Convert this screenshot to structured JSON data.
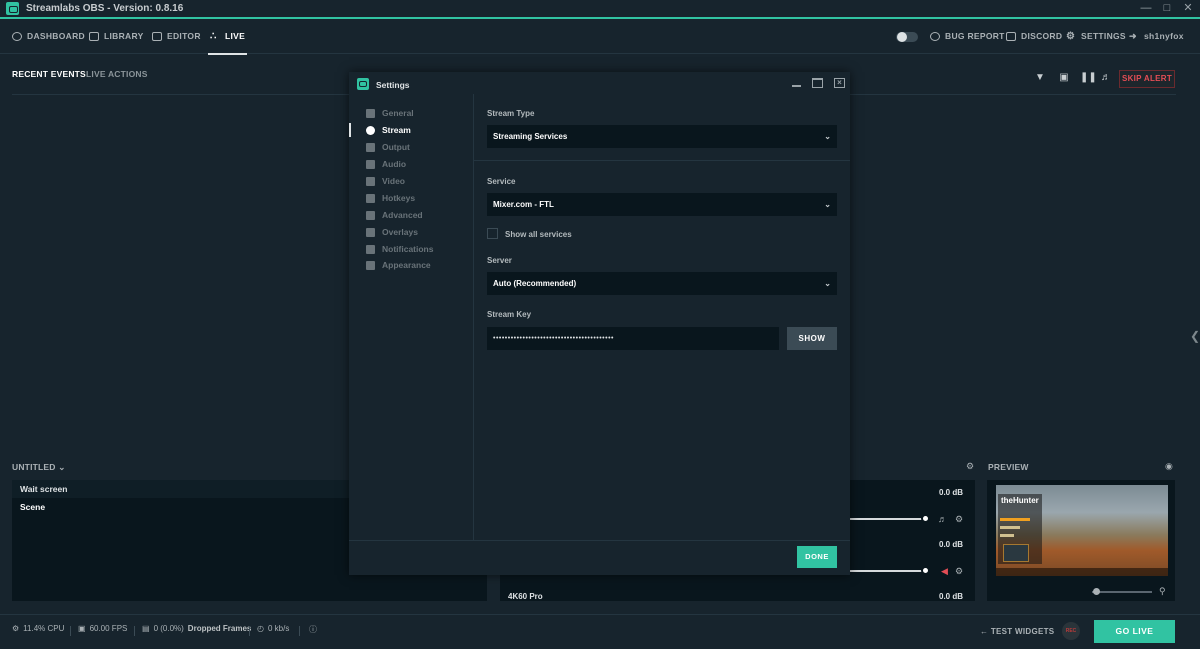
{
  "app": {
    "title": "Streamlabs OBS - Version: 0.8.16"
  },
  "nav": {
    "left": [
      {
        "label": "DASHBOARD",
        "icon": "dashboard-icon"
      },
      {
        "label": "LIBRARY",
        "icon": "image-icon"
      },
      {
        "label": "EDITOR",
        "icon": "editor-icon"
      },
      {
        "label": "LIVE",
        "icon": "broadcast-icon",
        "active": true
      }
    ],
    "right": [
      {
        "label": "BUG REPORT",
        "icon": "bug-icon"
      },
      {
        "label": "DISCORD",
        "icon": "discord-icon"
      },
      {
        "label": "SETTINGS",
        "icon": "gear-icon"
      },
      {
        "label": "sh1nyfox",
        "icon": "logout-icon"
      }
    ]
  },
  "events": {
    "tabs": [
      "RECENT EVENTS",
      "LIVE ACTIONS"
    ],
    "skip_alert": "SKIP ALERT"
  },
  "scenes": {
    "collection": "UNTITLED",
    "items": [
      "Wait screen",
      "Scene"
    ]
  },
  "mixer": {
    "items": [
      {
        "name": "",
        "db": "0.0 dB"
      },
      {
        "name": "",
        "db": "0.0 dB"
      },
      {
        "name": "4K60 Pro",
        "db": "0.0 dB"
      }
    ]
  },
  "preview": {
    "label": "PREVIEW",
    "game_title": "theHunter"
  },
  "footer": {
    "cpu": "11.4% CPU",
    "fps": "60.00 FPS",
    "dropped_count": "0 (0.0%)",
    "dropped_label": "Dropped Frames",
    "bitrate": "0 kb/s",
    "test_widgets": "TEST WIDGETS",
    "rec": "REC",
    "go_live": "GO LIVE"
  },
  "settings": {
    "title": "Settings",
    "sidebar": [
      {
        "label": "General",
        "icon": "grid-icon"
      },
      {
        "label": "Stream",
        "icon": "globe-icon",
        "active": true
      },
      {
        "label": "Output",
        "icon": "output-icon"
      },
      {
        "label": "Audio",
        "icon": "speaker-icon"
      },
      {
        "label": "Video",
        "icon": "film-icon"
      },
      {
        "label": "Hotkeys",
        "icon": "keyboard-icon"
      },
      {
        "label": "Advanced",
        "icon": "cogs-icon"
      },
      {
        "label": "Overlays",
        "icon": "image-icon"
      },
      {
        "label": "Notifications",
        "icon": "warning-icon"
      },
      {
        "label": "Appearance",
        "icon": "monitor-icon"
      }
    ],
    "stream_type": {
      "label": "Stream Type",
      "value": "Streaming Services"
    },
    "service": {
      "label": "Service",
      "value": "Mixer.com - FTL"
    },
    "show_all": {
      "label": "Show all services",
      "checked": false
    },
    "server": {
      "label": "Server",
      "value": "Auto (Recommended)"
    },
    "stream_key": {
      "label": "Stream Key",
      "value": "•••••••••••••••••••••••••••••••••••••••••",
      "show_label": "SHOW"
    },
    "done_label": "DONE"
  },
  "colors": {
    "accent": "#31c3a2",
    "background": "#17242d",
    "panel": "#09161d",
    "danger": "#e34d55"
  }
}
